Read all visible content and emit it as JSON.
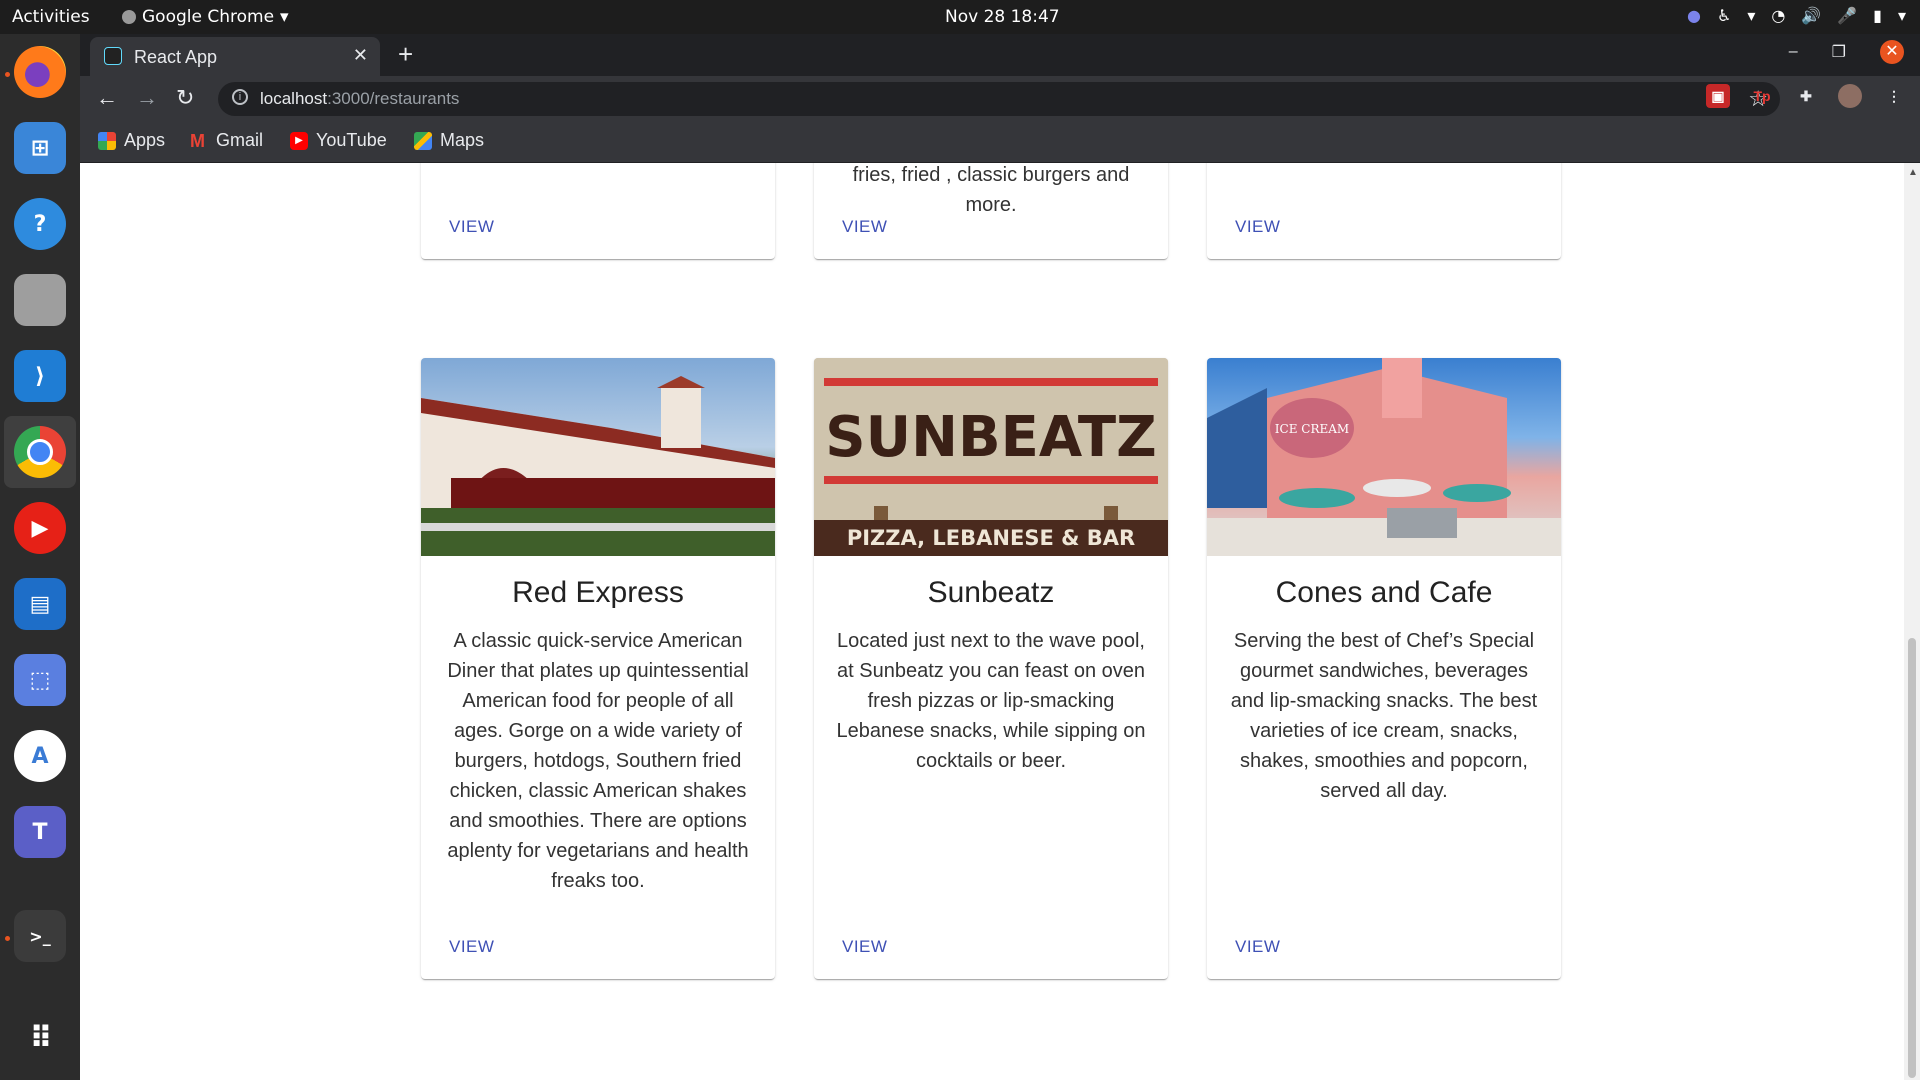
{
  "topbar": {
    "activities": "Activities",
    "app": "Google Chrome",
    "datetime": "Nov 28  18:47"
  },
  "dock": {
    "items": [
      "firefox-icon",
      "software-store-icon",
      "help-icon",
      "files-icon",
      "vscode-icon",
      "chrome-icon",
      "youtube-music-icon",
      "writer-icon",
      "screenshot-icon",
      "android-studio-icon",
      "teams-icon",
      "terminal-icon"
    ],
    "apps_grid": "apps-grid-icon"
  },
  "browser": {
    "tab_title": "React App",
    "url_host": "localhost",
    "url_path": ":3000/restaurants",
    "bookmarks": [
      "Apps",
      "Gmail",
      "YouTube",
      "Maps"
    ]
  },
  "page": {
    "top_cards": [
      {
        "text": "",
        "view": "VIEW"
      },
      {
        "text": "heart's content with the likes of fries, fried , classic burgers and more.",
        "view": "VIEW"
      },
      {
        "text": "",
        "view": "VIEW"
      }
    ],
    "cards": [
      {
        "name": "Red Express",
        "description": "A classic quick-service American Diner that plates up quintessential American food for people of all ages. Gorge on a wide variety of burgers, hotdogs, Southern fried chicken, classic American shakes and smoothies. There are options aplenty for vegetarians and health freaks too.",
        "view": "VIEW"
      },
      {
        "name": "Sunbeatz",
        "description": "Located just next to the wave pool, at Sunbeatz you can feast on oven fresh pizzas or lip-smacking Lebanese snacks, while sipping on cocktails or beer.",
        "view": "VIEW",
        "sign_title": "SUNBEATZ",
        "sign_subtitle": "PIZZA, LEBANESE & BAR"
      },
      {
        "name": "Cones and Cafe",
        "description": "Serving the best of Chef’s Special gourmet sandwiches, beverages and lip-smacking snacks. The best varieties of ice cream, snacks, shakes, smoothies and popcorn, served all day.",
        "view": "VIEW",
        "sign_text": "ICE CREAM"
      }
    ]
  },
  "colors": {
    "link": "#3f51b5",
    "chrome_dark": "#35363a",
    "topbar": "#1d1d1d",
    "dock": "#2c2c2c",
    "accent": "#e95420"
  }
}
